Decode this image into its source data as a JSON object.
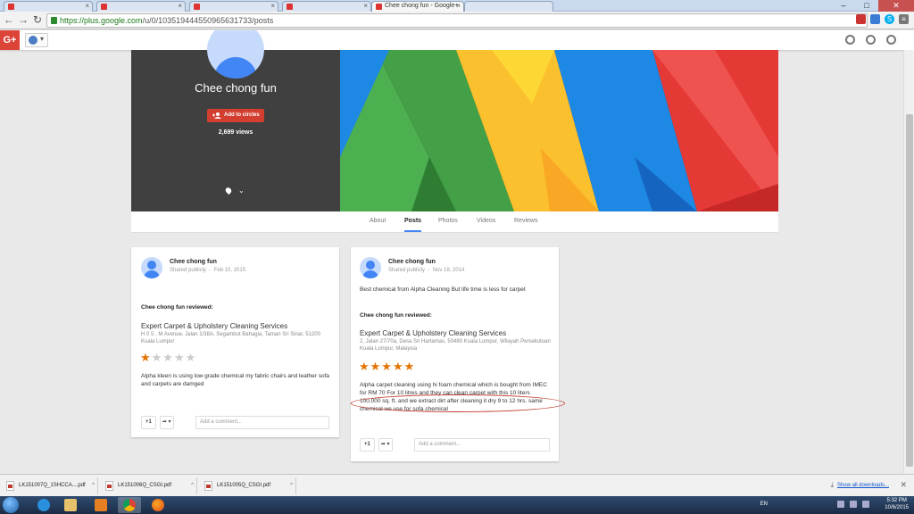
{
  "browser": {
    "tabs": [
      {
        "title": "",
        "active": false
      },
      {
        "title": "",
        "active": false
      },
      {
        "title": "Chee chong fun - Google+",
        "active": true
      },
      {
        "title": "",
        "active": false
      }
    ],
    "url_host": "https://plus.google.com",
    "url_path": "/u/0/103519444550965631733/posts"
  },
  "gplus": {
    "logo": "G+"
  },
  "profile": {
    "name": "Chee chong fun",
    "add_button": "Add to circles",
    "views": "2,699 views"
  },
  "tabs": [
    "About",
    "Posts",
    "Photos",
    "Videos",
    "Reviews"
  ],
  "posts": [
    {
      "author": "Chee chong fun",
      "visibility": "Shared publicly",
      "date": "Feb 10, 2015",
      "intro": "",
      "reviewed_label": "Chee chong fun reviewed:",
      "business": "Expert Carpet & Upholstery Cleaning Services",
      "address": "H 0 5 , M Avenue, Jalan 1/38A, Segambut Bahagia, Taman Sri Sinar, 51200 Kuala Lumpur",
      "rating": 1,
      "review": "Alpha kleen is using low grade chemical my fabric chairs and leather sofa and carpets are damged",
      "plus_one": "+1",
      "comment_placeholder": "Add a comment..."
    },
    {
      "author": "Chee chong fun",
      "visibility": "Shared publicly",
      "date": "Nov 18, 2014",
      "intro": "Best chemical from Alpha Cleaning But life time is less for carpet",
      "reviewed_label": "Chee chong fun reviewed:",
      "business": "Expert Carpet & Upholstery Cleaning Services",
      "address": "2, Jalan 27/70a, Desa Sri Hartamas, 50480 Kuala Lumpur, Wilayah Persekutuan Kuala Lumpur, Malaysia",
      "rating": 5,
      "review": "Alpha carpet cleaning using hi foam chemical which is bought from IMEC for RM 70 For 10 litres and they can clean carpet with this 10 liters 100,000 sq. ft. and we extract dirt after cleaning it dry 9 to 12 hrs. same chemical we use for sofa chemical",
      "plus_one": "+1",
      "comment_placeholder": "Add a comment..."
    }
  ],
  "downloads": {
    "items": [
      "LK151007Q_1SHCCA....pdf",
      "LK151006Q_CSGI.pdf",
      "LK151005Q_CSGI.pdf"
    ],
    "show_all": "Show all downloads..."
  },
  "taskbar": {
    "lang": "EN",
    "time": "5:32 PM",
    "date": "10/6/2015"
  },
  "colors": {
    "gplus_red": "#db4437",
    "add_button": "#d23f31",
    "star": "#e37400",
    "tab_underline": "#4285f4"
  }
}
